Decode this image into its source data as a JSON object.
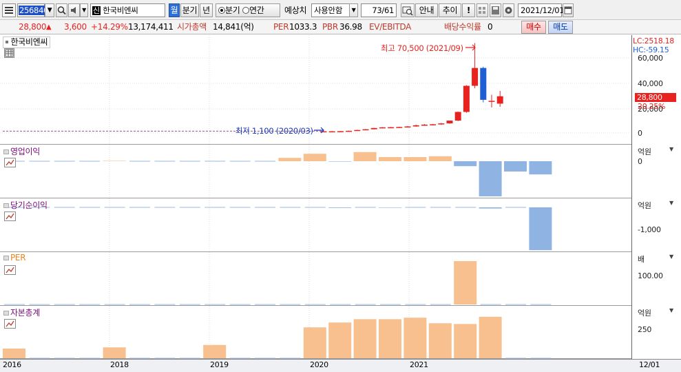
{
  "toolbar": {
    "code": "256840",
    "badge": "신",
    "name": "한국비엔씨",
    "mode_badge": "월",
    "period_btn": "분기",
    "year_btn": "년",
    "radio_quarter": "분기",
    "radio_annual": "연간",
    "forecast_label": "예상치",
    "forecast_select": "사용안함",
    "page_counter": "73/61",
    "btn_guide": "안내",
    "btn_trend": "추이",
    "btn_alert": "!",
    "date": "2021/12/01"
  },
  "quote": {
    "price": "28,800",
    "change": "3,600",
    "change_pct": "+14.29%",
    "volume": "13,174,411",
    "mcap_label": "시가총액",
    "mcap_value": "14,841(억)",
    "per_label": "PER",
    "per_value": "1033.3",
    "pbr_label": "PBR",
    "pbr_value": "36.98",
    "ev_label": "EV/EBITDA",
    "div_label": "배당수익률",
    "div_value": "0",
    "buy_btn": "매수",
    "sell_btn": "매도"
  },
  "price_pane": {
    "title": "한국비엔씨",
    "high_annotation": "최고 70,500 (2021/09)",
    "low_annotation": "최저 1,100 (2020/03)",
    "lc": "LC:2518.18",
    "hc": "HC:-59.15",
    "current_price": "28,800",
    "current_pct": "20.25%",
    "ticks": [
      "60,000",
      "40,000",
      "20,000",
      "0"
    ]
  },
  "panes": [
    {
      "title": "영업이익",
      "unit": "억원",
      "ticks": [
        "0"
      ]
    },
    {
      "title": "당기순이익",
      "unit": "억원",
      "ticks": [
        "-1,000"
      ]
    },
    {
      "title": "PER",
      "unit": "배",
      "ticks": [
        "100.00"
      ]
    },
    {
      "title": "자본총계",
      "unit": "억원",
      "ticks": [
        "250"
      ]
    }
  ],
  "x_axis": {
    "labels": [
      "2016",
      "2018",
      "2019",
      "2020",
      "2021"
    ],
    "right_label": "12/01"
  },
  "colors": {
    "up": "#e8231f",
    "down": "#1f5fd6",
    "bar_pos": "#f8c08e",
    "bar_neg": "#8fb4e3",
    "title": "#7a0a7a"
  },
  "chart_data": [
    {
      "type": "candlestick",
      "title": "한국비엔씨",
      "ylim": [
        0,
        70500
      ],
      "x": [
        "2020/03",
        "2020/04",
        "2020/05",
        "2020/06",
        "2020/07",
        "2020/08",
        "2020/09",
        "2020/10",
        "2020/11",
        "2020/12",
        "2021/01",
        "2021/02",
        "2021/03",
        "2021/04",
        "2021/05",
        "2021/06",
        "2021/07",
        "2021/08",
        "2021/09",
        "2021/10",
        "2021/11",
        "2021/12"
      ],
      "open": [
        1100,
        1300,
        1300,
        1400,
        1700,
        2300,
        2900,
        3900,
        4400,
        4500,
        4700,
        5100,
        6000,
        6500,
        6800,
        7500,
        9700,
        16500,
        37000,
        51000,
        25000,
        23000
      ],
      "high": [
        1300,
        1500,
        1500,
        1800,
        2500,
        3100,
        4000,
        4600,
        4700,
        4900,
        5400,
        6500,
        7000,
        7000,
        7800,
        8500,
        16800,
        37500,
        70500,
        52000,
        30000,
        33000
      ],
      "close": [
        1300,
        1300,
        1400,
        1700,
        2300,
        2900,
        3900,
        4400,
        4500,
        4700,
        5100,
        6000,
        6500,
        6800,
        7500,
        9700,
        16500,
        37000,
        51000,
        26000,
        25200,
        28800
      ],
      "low": [
        1100,
        1200,
        1200,
        1300,
        1600,
        2200,
        2800,
        3700,
        4000,
        4200,
        4500,
        4900,
        5600,
        6000,
        6400,
        7200,
        9300,
        15800,
        35000,
        24000,
        20000,
        20500
      ]
    },
    {
      "type": "bar",
      "title": "영업이익",
      "ylabel": "억원",
      "x": [
        "2016/Q3",
        "2016/Q4",
        "2017/Q1",
        "2017/Q2",
        "2017/Q3",
        "2017/Q4",
        "2018/Q1",
        "2018/Q2",
        "2018/Q3",
        "2018/Q4",
        "2019/Q1",
        "2019/Q2",
        "2019/Q3",
        "2019/Q4",
        "2020/Q1",
        "2020/Q2",
        "2020/Q3",
        "2020/Q4",
        "2021/Q1",
        "2021/Q2",
        "2021/Q3"
      ],
      "values": [
        0,
        0,
        0,
        0,
        1,
        0,
        0,
        0,
        0,
        0,
        0,
        8,
        18,
        -1,
        22,
        10,
        10,
        12,
        -12,
        -85,
        -25,
        -32
      ]
    },
    {
      "type": "bar",
      "title": "당기순이익",
      "ylabel": "억원",
      "values": [
        0,
        0,
        0,
        0,
        0,
        0,
        0,
        0,
        0,
        0,
        0,
        0,
        0,
        -20,
        0,
        -15,
        0,
        0,
        0,
        -40,
        0,
        -1480
      ]
    },
    {
      "type": "bar",
      "title": "PER",
      "ylabel": "배",
      "values": [
        0,
        0,
        0,
        0,
        0,
        0,
        0,
        0,
        0,
        0,
        0,
        0,
        0,
        0,
        0,
        0,
        0,
        0,
        175,
        0,
        0,
        0
      ]
    },
    {
      "type": "bar",
      "title": "자본총계",
      "ylabel": "억원",
      "values": [
        40,
        0,
        0,
        0,
        45,
        0,
        0,
        0,
        55,
        0,
        0,
        0,
        128,
        148,
        162,
        162,
        168,
        145,
        142,
        172,
        0,
        0
      ]
    }
  ]
}
